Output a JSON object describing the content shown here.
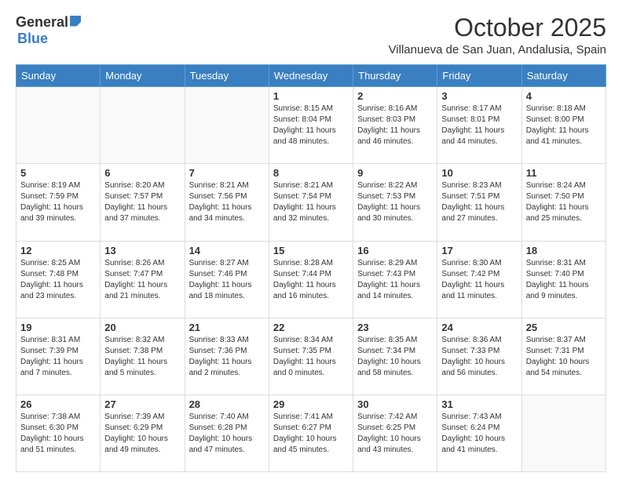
{
  "header": {
    "logo_general": "General",
    "logo_blue": "Blue",
    "month_title": "October 2025",
    "location": "Villanueva de San Juan, Andalusia, Spain"
  },
  "days_of_week": [
    "Sunday",
    "Monday",
    "Tuesday",
    "Wednesday",
    "Thursday",
    "Friday",
    "Saturday"
  ],
  "weeks": [
    [
      {
        "day": "",
        "info": ""
      },
      {
        "day": "",
        "info": ""
      },
      {
        "day": "",
        "info": ""
      },
      {
        "day": "1",
        "info": "Sunrise: 8:15 AM\nSunset: 8:04 PM\nDaylight: 11 hours and 48 minutes."
      },
      {
        "day": "2",
        "info": "Sunrise: 8:16 AM\nSunset: 8:03 PM\nDaylight: 11 hours and 46 minutes."
      },
      {
        "day": "3",
        "info": "Sunrise: 8:17 AM\nSunset: 8:01 PM\nDaylight: 11 hours and 44 minutes."
      },
      {
        "day": "4",
        "info": "Sunrise: 8:18 AM\nSunset: 8:00 PM\nDaylight: 11 hours and 41 minutes."
      }
    ],
    [
      {
        "day": "5",
        "info": "Sunrise: 8:19 AM\nSunset: 7:59 PM\nDaylight: 11 hours and 39 minutes."
      },
      {
        "day": "6",
        "info": "Sunrise: 8:20 AM\nSunset: 7:57 PM\nDaylight: 11 hours and 37 minutes."
      },
      {
        "day": "7",
        "info": "Sunrise: 8:21 AM\nSunset: 7:56 PM\nDaylight: 11 hours and 34 minutes."
      },
      {
        "day": "8",
        "info": "Sunrise: 8:21 AM\nSunset: 7:54 PM\nDaylight: 11 hours and 32 minutes."
      },
      {
        "day": "9",
        "info": "Sunrise: 8:22 AM\nSunset: 7:53 PM\nDaylight: 11 hours and 30 minutes."
      },
      {
        "day": "10",
        "info": "Sunrise: 8:23 AM\nSunset: 7:51 PM\nDaylight: 11 hours and 27 minutes."
      },
      {
        "day": "11",
        "info": "Sunrise: 8:24 AM\nSunset: 7:50 PM\nDaylight: 11 hours and 25 minutes."
      }
    ],
    [
      {
        "day": "12",
        "info": "Sunrise: 8:25 AM\nSunset: 7:48 PM\nDaylight: 11 hours and 23 minutes."
      },
      {
        "day": "13",
        "info": "Sunrise: 8:26 AM\nSunset: 7:47 PM\nDaylight: 11 hours and 21 minutes."
      },
      {
        "day": "14",
        "info": "Sunrise: 8:27 AM\nSunset: 7:46 PM\nDaylight: 11 hours and 18 minutes."
      },
      {
        "day": "15",
        "info": "Sunrise: 8:28 AM\nSunset: 7:44 PM\nDaylight: 11 hours and 16 minutes."
      },
      {
        "day": "16",
        "info": "Sunrise: 8:29 AM\nSunset: 7:43 PM\nDaylight: 11 hours and 14 minutes."
      },
      {
        "day": "17",
        "info": "Sunrise: 8:30 AM\nSunset: 7:42 PM\nDaylight: 11 hours and 11 minutes."
      },
      {
        "day": "18",
        "info": "Sunrise: 8:31 AM\nSunset: 7:40 PM\nDaylight: 11 hours and 9 minutes."
      }
    ],
    [
      {
        "day": "19",
        "info": "Sunrise: 8:31 AM\nSunset: 7:39 PM\nDaylight: 11 hours and 7 minutes."
      },
      {
        "day": "20",
        "info": "Sunrise: 8:32 AM\nSunset: 7:38 PM\nDaylight: 11 hours and 5 minutes."
      },
      {
        "day": "21",
        "info": "Sunrise: 8:33 AM\nSunset: 7:36 PM\nDaylight: 11 hours and 2 minutes."
      },
      {
        "day": "22",
        "info": "Sunrise: 8:34 AM\nSunset: 7:35 PM\nDaylight: 11 hours and 0 minutes."
      },
      {
        "day": "23",
        "info": "Sunrise: 8:35 AM\nSunset: 7:34 PM\nDaylight: 10 hours and 58 minutes."
      },
      {
        "day": "24",
        "info": "Sunrise: 8:36 AM\nSunset: 7:33 PM\nDaylight: 10 hours and 56 minutes."
      },
      {
        "day": "25",
        "info": "Sunrise: 8:37 AM\nSunset: 7:31 PM\nDaylight: 10 hours and 54 minutes."
      }
    ],
    [
      {
        "day": "26",
        "info": "Sunrise: 7:38 AM\nSunset: 6:30 PM\nDaylight: 10 hours and 51 minutes."
      },
      {
        "day": "27",
        "info": "Sunrise: 7:39 AM\nSunset: 6:29 PM\nDaylight: 10 hours and 49 minutes."
      },
      {
        "day": "28",
        "info": "Sunrise: 7:40 AM\nSunset: 6:28 PM\nDaylight: 10 hours and 47 minutes."
      },
      {
        "day": "29",
        "info": "Sunrise: 7:41 AM\nSunset: 6:27 PM\nDaylight: 10 hours and 45 minutes."
      },
      {
        "day": "30",
        "info": "Sunrise: 7:42 AM\nSunset: 6:25 PM\nDaylight: 10 hours and 43 minutes."
      },
      {
        "day": "31",
        "info": "Sunrise: 7:43 AM\nSunset: 6:24 PM\nDaylight: 10 hours and 41 minutes."
      },
      {
        "day": "",
        "info": ""
      }
    ]
  ]
}
